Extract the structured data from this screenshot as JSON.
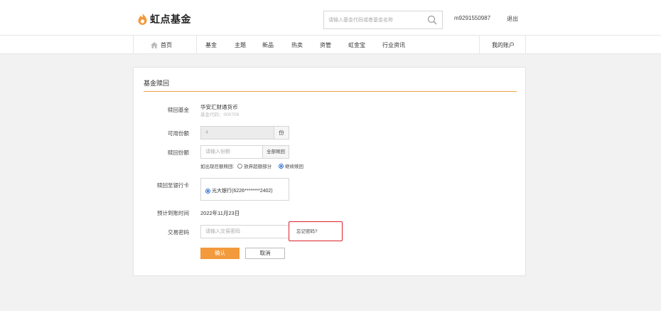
{
  "header": {
    "logo_text": "虹点基金",
    "search_placeholder": "请输入基金代码或者基金名称",
    "account": "m9291550987",
    "logout": "退出"
  },
  "nav": {
    "home": "首页",
    "items": [
      "基金",
      "主题",
      "新品",
      "热卖",
      "资管",
      "虹金宝",
      "行业资讯"
    ],
    "my_account": "我的账户"
  },
  "form": {
    "title": "基金赎回",
    "fund_label": "赎回基金",
    "fund_name": "华安汇财通货币",
    "fund_code": "基金代码：000709",
    "available_label": "可用份额",
    "available_value": "4",
    "available_unit": "份",
    "redeem_label": "赎回份额",
    "redeem_placeholder": "请输入份额",
    "redeem_all": "全部赎回",
    "large_label": "如出现巨额赎回:",
    "large_opt1": "放弃超额部分",
    "large_opt2": "继续赎回",
    "large_selected": 2,
    "bank_label": "赎回至银行卡",
    "bank_value": "光大银行(6226********2402)",
    "arrival_label": "预计到账时间",
    "arrival_value": "2022年11月23日",
    "password_label": "交易密码",
    "password_placeholder": "请输入交易密码",
    "forgot": "忘记密码?",
    "confirm": "确认",
    "cancel": "取消"
  },
  "colors": {
    "accent": "#f29a3c",
    "highlight_border": "#d9232d",
    "radio": "#2b6fd6"
  }
}
